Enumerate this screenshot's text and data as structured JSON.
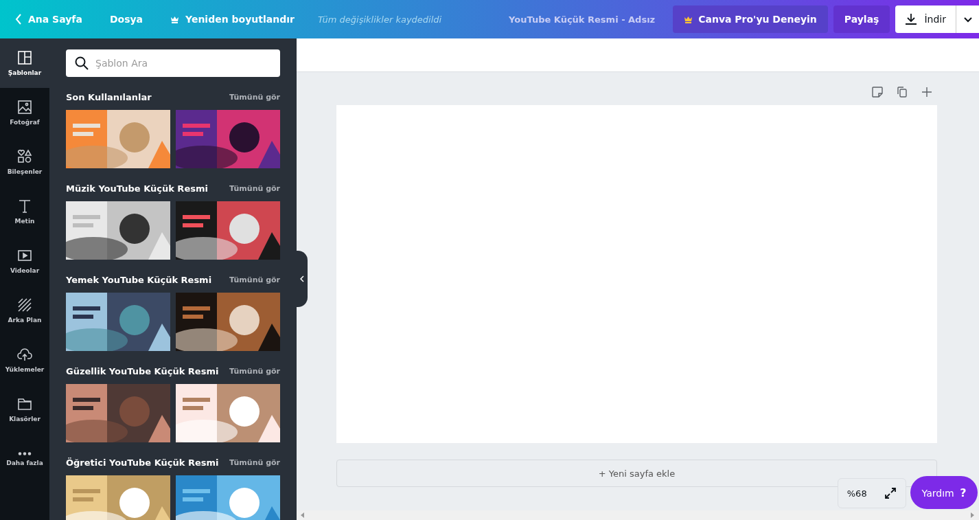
{
  "topbar": {
    "home": "Ana Sayfa",
    "file": "Dosya",
    "resize": "Yeniden boyutlandır",
    "save_status": "Tüm değişiklikler kaydedildi",
    "doc_title": "YouTube Küçük Resmi - Adsız",
    "pro": "Canva Pro'yu Deneyin",
    "share": "Paylaş",
    "download": "İndir"
  },
  "rail": [
    {
      "label": "Şablonlar",
      "selected": true
    },
    {
      "label": "Fotoğraf",
      "selected": false
    },
    {
      "label": "Bileşenler",
      "selected": false
    },
    {
      "label": "Metin",
      "selected": false
    },
    {
      "label": "Videolar",
      "selected": false
    },
    {
      "label": "Arka Plan",
      "selected": false
    },
    {
      "label": "Yüklemeler",
      "selected": false
    },
    {
      "label": "Klasörler",
      "selected": false
    },
    {
      "label": "Daha fazla",
      "selected": false
    }
  ],
  "search": {
    "placeholder": "Şablon Ara"
  },
  "sections": [
    {
      "title": "Son Kullanılanlar",
      "see_all": "Tümünü gör"
    },
    {
      "title": "Müzik YouTube Küçük Resmi",
      "see_all": "Tümünü gör"
    },
    {
      "title": "Yemek YouTube Küçük Resmi",
      "see_all": "Tümünü gör"
    },
    {
      "title": "Güzellik YouTube Küçük Resmi",
      "see_all": "Tümünü gör"
    },
    {
      "title": "Öğretici YouTube Küçük Resmi",
      "see_all": "Tümünü gör"
    }
  ],
  "add_page": "+ Yeni sayfa ekle",
  "zoom": "%68",
  "help": {
    "label": "Yardım",
    "mark": "?"
  }
}
